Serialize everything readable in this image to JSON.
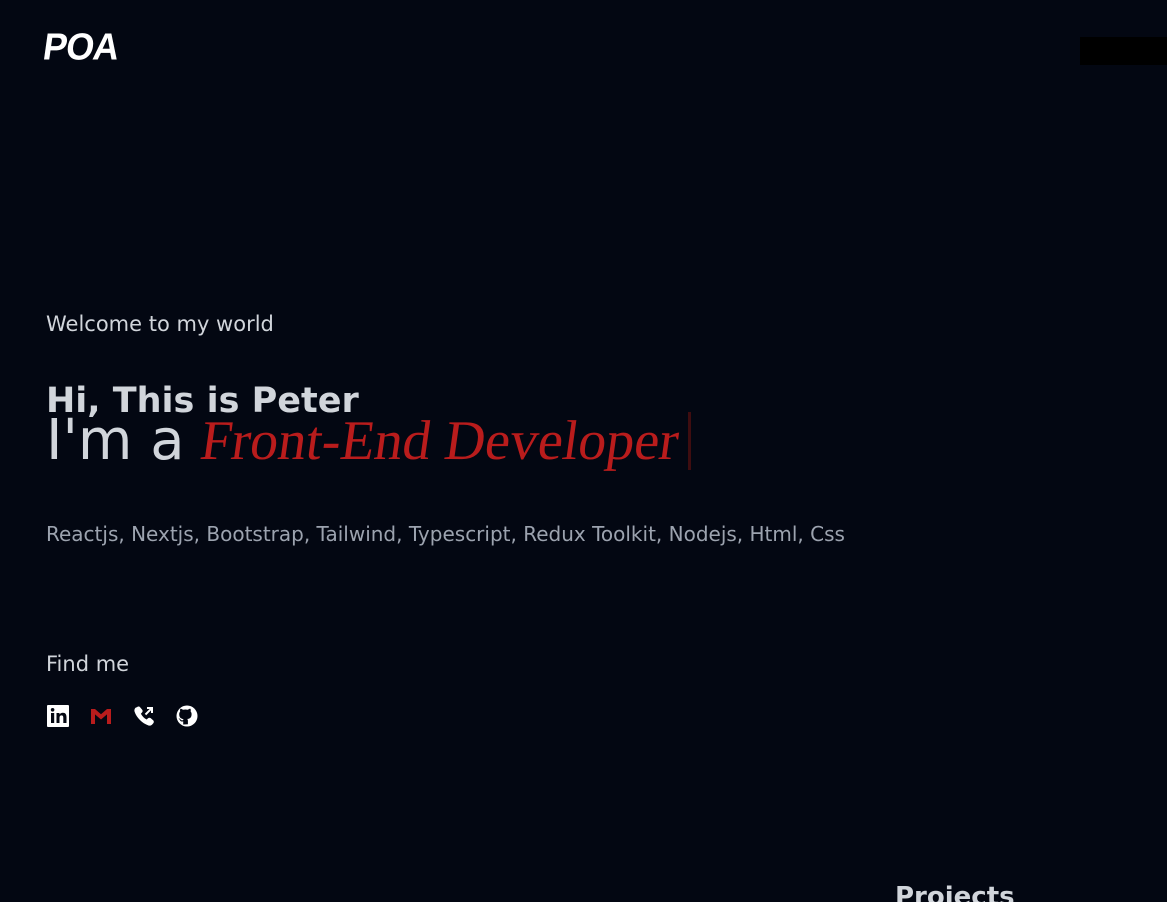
{
  "header": {
    "logo_text": "POA",
    "nav_menu_icon": "menu-block-icon"
  },
  "hero": {
    "welcome": "Welcome to my world",
    "greeting": "Hi, This is Peter",
    "role_prefix": "I'm a",
    "role_title": "Front-End Developer",
    "skills": "Reactjs, Nextjs, Bootstrap, Tailwind, Typescript, Redux Toolkit, Nodejs, Html, Css"
  },
  "find_me": {
    "label": "Find me",
    "links": [
      {
        "icon": "linkedin-icon"
      },
      {
        "icon": "gmail-icon"
      },
      {
        "icon": "phone-icon"
      },
      {
        "icon": "github-icon"
      }
    ]
  },
  "projects": {
    "heading": "Projects"
  },
  "colors": {
    "background": "#030712",
    "text": "#d1d5db",
    "muted_text": "#9ca3af",
    "accent": "#b91c1c",
    "logo": "#ffffff",
    "cursor": "#3f0d10",
    "nav_block": "#000000"
  }
}
